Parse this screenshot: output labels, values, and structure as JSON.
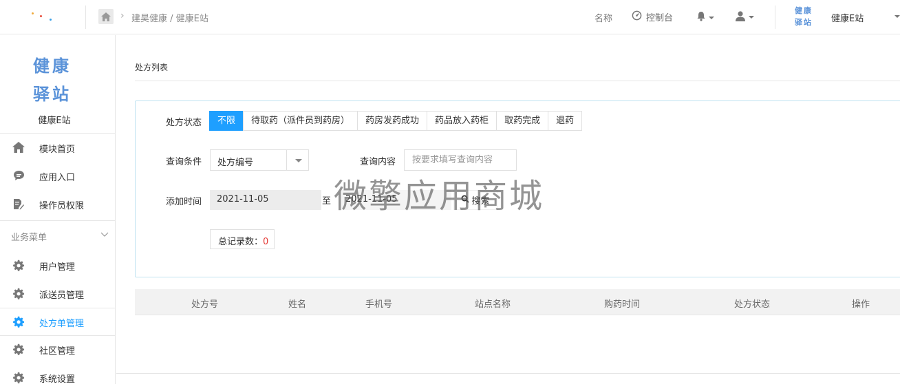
{
  "header": {
    "breadcrumb": "建昊健康 / 健康E站",
    "name_label": "名称",
    "console_label": "控制台",
    "logo_text": "健康驿站",
    "station_name": "健康E站"
  },
  "sidebar": {
    "brand_title": "健康驿站",
    "brand_subtitle": "健康E站",
    "top_items": [
      {
        "label": "模块首页",
        "icon": "home-icon"
      },
      {
        "label": "应用入口",
        "icon": "chat-bubble-icon"
      },
      {
        "label": "操作员权限",
        "icon": "document-edit-icon"
      }
    ],
    "group_label": "业务菜单",
    "group_items": [
      {
        "label": "用户管理",
        "icon": "gear-icon"
      },
      {
        "label": "派送员管理",
        "icon": "gear-icon"
      },
      {
        "label": "处方单管理",
        "icon": "gear-icon",
        "active": true
      },
      {
        "label": "社区管理",
        "icon": "gear-icon"
      },
      {
        "label": "系统设置",
        "icon": "gear-icon"
      }
    ]
  },
  "main": {
    "page_title": "处方列表",
    "filters": {
      "status_label": "处方状态",
      "status_tabs": [
        "不限",
        "待取药（派件员到药房）",
        "药房发药成功",
        "药品放入药柜",
        "取药完成",
        "退药"
      ],
      "condition_label": "查询条件",
      "condition_value": "处方编号",
      "query_label": "查询内容",
      "query_placeholder": "按要求填写查询内容",
      "date_label": "添加时间",
      "date_from": "2021-11-05",
      "date_to_label": "至",
      "date_to": "2021-11-05",
      "search_label": "搜索",
      "count_label": "总记录数：",
      "count_value": "0"
    },
    "table_headers": [
      "处方号",
      "姓名",
      "手机号",
      "站点名称",
      "购药时间",
      "处方状态",
      "操作"
    ],
    "watermark": "微擎应用商城"
  },
  "colors": {
    "accent": "#1e9fff",
    "brand_blue": "#5b93d9",
    "count_red": "#e53935"
  }
}
